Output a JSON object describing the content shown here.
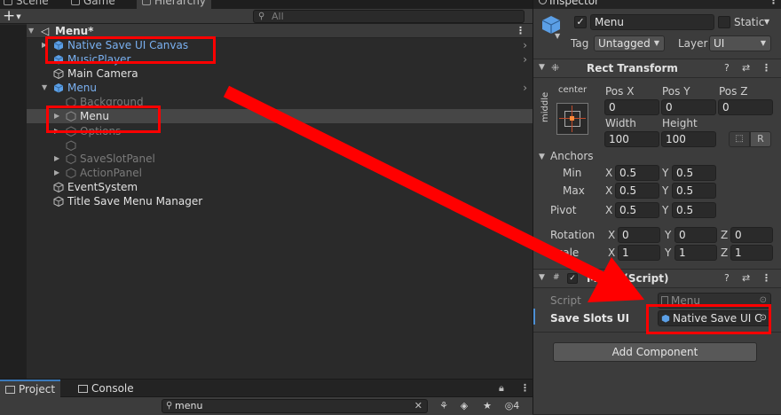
{
  "hierarchy": {
    "tabs": [
      {
        "label": "Scene"
      },
      {
        "label": "Game"
      },
      {
        "label": "Hierarchy"
      }
    ],
    "search_placeholder": "All",
    "scene_name": "Menu*",
    "items": [
      {
        "label": "Native Save UI Canvas",
        "color": "#7ab0f0",
        "depth": 1
      },
      {
        "label": "MusicPlayer",
        "color": "#7ab0f0",
        "depth": 1
      },
      {
        "label": "Main Camera",
        "color": "#e2e2e2",
        "depth": 1
      },
      {
        "label": "Menu",
        "color": "#7ab0f0",
        "depth": 1
      },
      {
        "label": "Background",
        "color": "#7a7a7a",
        "depth": 2
      },
      {
        "label": "Menu",
        "color": "#e2e2e2",
        "depth": 2
      },
      {
        "label": "Options",
        "color": "#7a7a7a",
        "depth": 2
      },
      {
        "label": "SaveSlotPanel",
        "color": "#7a7a7a",
        "depth": 2
      },
      {
        "label": "ActionPanel",
        "color": "#7a7a7a",
        "depth": 2
      },
      {
        "label": "EventSystem",
        "color": "#e2e2e2",
        "depth": 1
      },
      {
        "label": "Title Save Menu Manager",
        "color": "#e2e2e2",
        "depth": 1
      }
    ]
  },
  "project": {
    "tabs": [
      {
        "label": "Project"
      },
      {
        "label": "Console"
      }
    ],
    "search_value": "menu",
    "hidden_count": "4"
  },
  "inspector": {
    "tab_label": "Inspector",
    "object_name": "Menu",
    "static_label": "Static",
    "tag_label": "Tag",
    "tag_value": "Untagged",
    "layer_label": "Layer",
    "layer_value": "UI",
    "rect_transform": {
      "title": "Rect Transform",
      "anchor_h": "center",
      "anchor_v": "middle",
      "pos_x_label": "Pos X",
      "pos_y_label": "Pos Y",
      "pos_z_label": "Pos Z",
      "pos_x": "0",
      "pos_y": "0",
      "pos_z": "0",
      "width_label": "Width",
      "height_label": "Height",
      "width": "100",
      "height": "100",
      "raw_label": "R",
      "anchors_label": "Anchors",
      "min_label": "Min",
      "min_x": "0.5",
      "min_y": "0.5",
      "max_label": "Max",
      "max_x": "0.5",
      "max_y": "0.5",
      "pivot_label": "Pivot",
      "pivot_x": "0.5",
      "pivot_y": "0.5",
      "rotation_label": "Rotation",
      "rot_x": "0",
      "rot_y": "0",
      "rot_z": "0",
      "scale_label": "Scale",
      "scale_x": "1",
      "scale_y": "1",
      "scale_z": "1",
      "x": "X",
      "y": "Y",
      "z": "Z"
    },
    "script_component": {
      "title": "Menu (Script)",
      "script_label": "Script",
      "script_value": "Menu",
      "field_label": "Save Slots UI",
      "field_value": "Native Save UI C"
    },
    "add_component_label": "Add Component"
  },
  "annotation_color": "#ff0000"
}
